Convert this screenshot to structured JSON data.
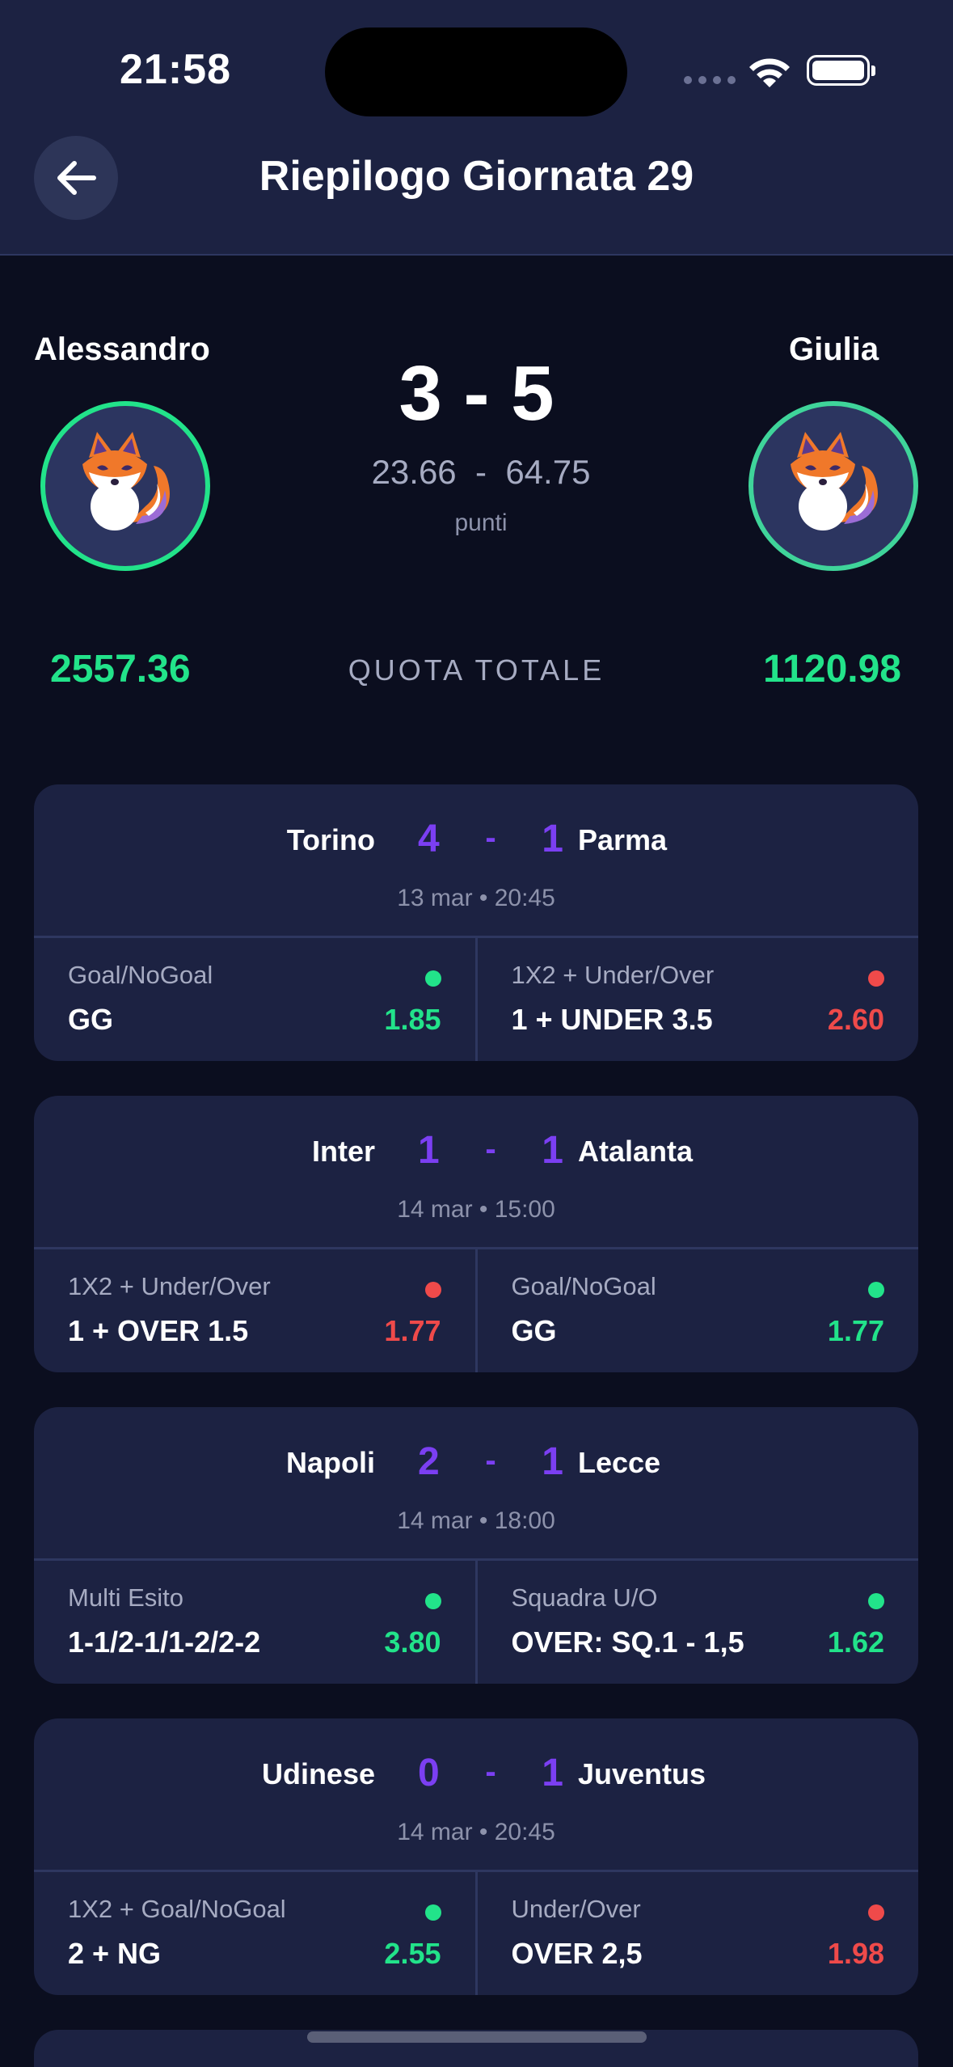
{
  "status_bar": {
    "time": "21:58"
  },
  "header": {
    "title": "Riepilogo Giornata 29"
  },
  "summary": {
    "player_left": {
      "name": "Alessandro",
      "quota": "2557.36"
    },
    "player_right": {
      "name": "Giulia",
      "quota": "1120.98"
    },
    "score": "3 - 5",
    "points": "23.66  -  64.75",
    "points_label": "punti",
    "quota_label": "QUOTA TOTALE"
  },
  "matches": [
    {
      "home": "Torino",
      "away": "Parma",
      "home_goals": "4",
      "away_goals": "1",
      "dash": "-",
      "date": "13 mar • 20:45",
      "bets": [
        {
          "type": "Goal/NoGoal",
          "pick": "GG",
          "odds": "1.85",
          "result": "win"
        },
        {
          "type": "1X2 + Under/Over",
          "pick": "1 + UNDER 3.5",
          "odds": "2.60",
          "result": "lose"
        }
      ]
    },
    {
      "home": "Inter",
      "away": "Atalanta",
      "home_goals": "1",
      "away_goals": "1",
      "dash": "-",
      "date": "14 mar • 15:00",
      "bets": [
        {
          "type": "1X2 + Under/Over",
          "pick": "1 + OVER 1.5",
          "odds": "1.77",
          "result": "lose"
        },
        {
          "type": "Goal/NoGoal",
          "pick": "GG",
          "odds": "1.77",
          "result": "win"
        }
      ]
    },
    {
      "home": "Napoli",
      "away": "Lecce",
      "home_goals": "2",
      "away_goals": "1",
      "dash": "-",
      "date": "14 mar • 18:00",
      "bets": [
        {
          "type": "Multi Esito",
          "pick": "1-1/2-1/1-2/2-2",
          "odds": "3.80",
          "result": "win"
        },
        {
          "type": "Squadra U/O",
          "pick": "OVER: SQ.1 - 1,5",
          "odds": "1.62",
          "result": "win"
        }
      ]
    },
    {
      "home": "Udinese",
      "away": "Juventus",
      "home_goals": "0",
      "away_goals": "1",
      "dash": "-",
      "date": "14 mar • 20:45",
      "bets": [
        {
          "type": "1X2 + Goal/NoGoal",
          "pick": "2 + NG",
          "odds": "2.55",
          "result": "win"
        },
        {
          "type": "Under/Over",
          "pick": "OVER 2,5",
          "odds": "1.98",
          "result": "lose"
        }
      ]
    }
  ],
  "colors": {
    "win": "#22e38a",
    "lose": "#ef4a4a",
    "score_accent": "#7b3ff2"
  }
}
